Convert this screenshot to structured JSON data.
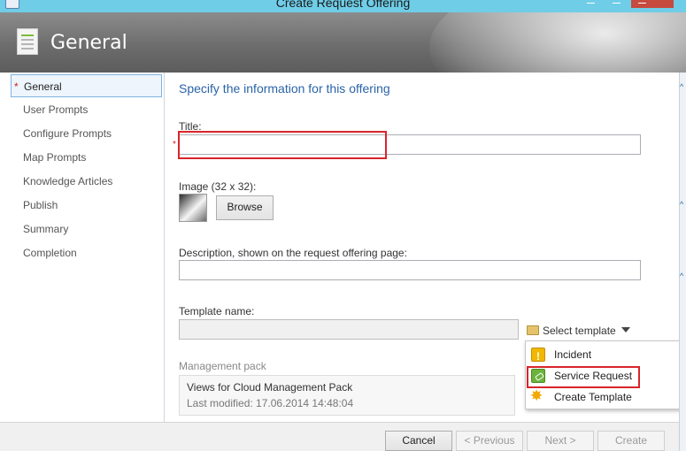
{
  "window": {
    "title": "Create Request Offering"
  },
  "header": {
    "title": "General"
  },
  "sidebar": {
    "items": [
      {
        "label": "General",
        "required_mark": "*"
      },
      {
        "label": "User Prompts"
      },
      {
        "label": "Configure Prompts"
      },
      {
        "label": "Map Prompts"
      },
      {
        "label": "Knowledge Articles"
      },
      {
        "label": "Publish"
      },
      {
        "label": "Summary"
      },
      {
        "label": "Completion"
      }
    ]
  },
  "form": {
    "section_title": "Specify the information for this offering",
    "title_label": "Title:",
    "title_value": "",
    "required_mark": "*",
    "image_label": "Image (32 x 32):",
    "browse_label": "Browse",
    "description_label": "Description, shown on the request offering page:",
    "description_value": "",
    "template_label": "Template name:",
    "template_value": "",
    "select_template_label": "Select template",
    "management_pack_label": "Management pack",
    "management_pack_name": "Views for Cloud Management Pack",
    "management_pack_modified": "Last modified:  17.06.2014 14:48:04"
  },
  "template_menu": {
    "items": [
      {
        "label": "Incident",
        "icon": "incident-icon"
      },
      {
        "label": "Service Request",
        "icon": "service-request-icon"
      },
      {
        "label": "Create Template",
        "icon": "create-template-icon"
      }
    ]
  },
  "footer": {
    "cancel": "Cancel",
    "previous": "< Previous",
    "next": "Next >",
    "create": "Create"
  },
  "colors": {
    "accent_blue": "#2a63a8",
    "highlight_red": "#d9242b",
    "titlebar": "#6fcde7"
  }
}
